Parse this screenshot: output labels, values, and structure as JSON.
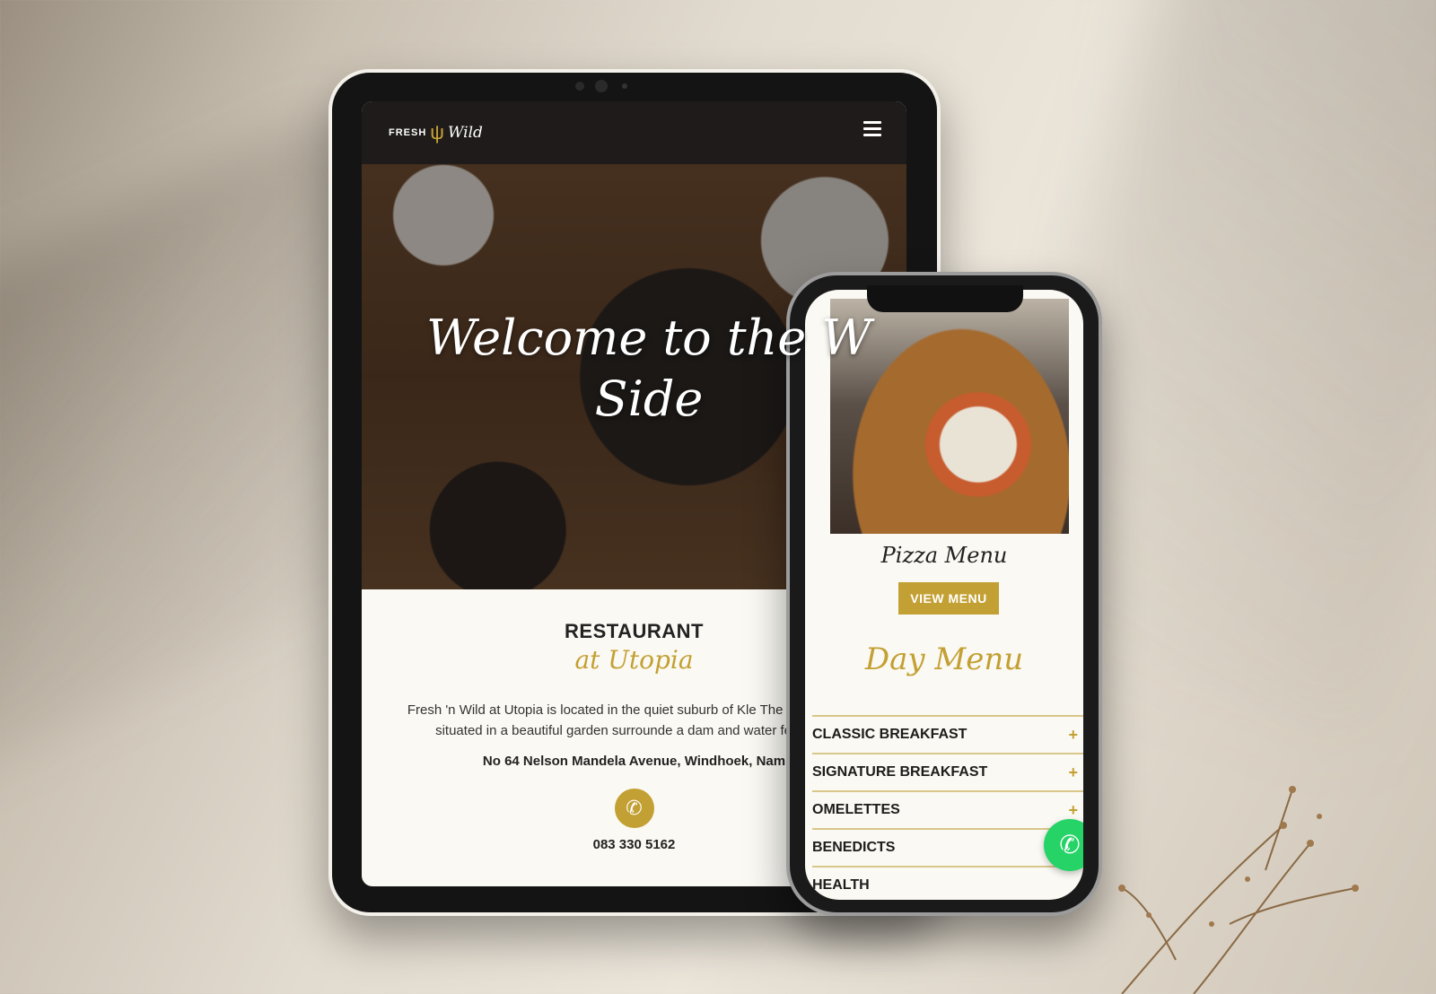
{
  "tablet": {
    "logo": {
      "fresh": "FRESH",
      "wild": "Wild"
    },
    "hero_title": "Welcome to the W Side",
    "restaurant_heading": "RESTAURANT",
    "restaurant_subheading": "at Utopia",
    "description": "Fresh 'n Wild at Utopia is located in the quiet suburb of Kle The restaurant is situated in a beautiful garden surrounde a dam and water features.",
    "address": "No 64 Nelson Mandela Avenue, Windhoek, Nam",
    "phone": "083 330 5162",
    "icons": {
      "menu": "hamburger-icon",
      "phone": "phone-icon"
    }
  },
  "phone": {
    "pizza_menu_title": "Pizza Menu",
    "view_menu_label": "VIEW MENU",
    "day_menu_title": "Day Menu",
    "menu_items": [
      {
        "label": "CLASSIC BREAKFAST",
        "icon": "+"
      },
      {
        "label": "SIGNATURE BREAKFAST",
        "icon": "+"
      },
      {
        "label": "OMELETTES",
        "icon": "+"
      },
      {
        "label": "BENEDICTS",
        "icon": ""
      },
      {
        "label": "HEALTH",
        "icon": ""
      }
    ],
    "icons": {
      "whatsapp": "whatsapp-icon"
    }
  },
  "colors": {
    "accent": "#c3a033",
    "nav": "#1f1b1a",
    "whatsapp": "#25d366"
  }
}
